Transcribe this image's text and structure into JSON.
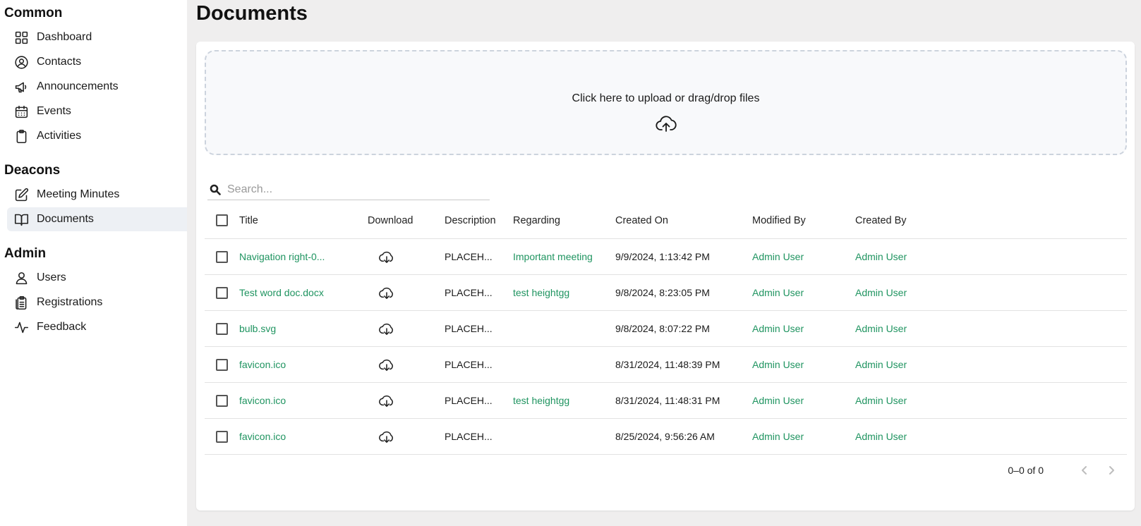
{
  "sidebar": {
    "sections": [
      {
        "title": "Common",
        "items": [
          {
            "label": "Dashboard",
            "icon": "dashboard-icon"
          },
          {
            "label": "Contacts",
            "icon": "contacts-icon"
          },
          {
            "label": "Announcements",
            "icon": "megaphone-icon"
          },
          {
            "label": "Events",
            "icon": "calendar-icon"
          },
          {
            "label": "Activities",
            "icon": "clipboard-icon"
          }
        ]
      },
      {
        "title": "Deacons",
        "items": [
          {
            "label": "Meeting Minutes",
            "icon": "edit-icon"
          },
          {
            "label": "Documents",
            "icon": "book-icon",
            "active": true
          }
        ]
      },
      {
        "title": "Admin",
        "items": [
          {
            "label": "Users",
            "icon": "user-icon"
          },
          {
            "label": "Registrations",
            "icon": "clipboard-list-icon"
          },
          {
            "label": "Feedback",
            "icon": "activity-icon"
          }
        ]
      }
    ]
  },
  "page": {
    "title": "Documents"
  },
  "upload": {
    "text": "Click here to upload or drag/drop files"
  },
  "search": {
    "placeholder": "Search..."
  },
  "table": {
    "columns": [
      "Title",
      "Download",
      "Description",
      "Regarding",
      "Created On",
      "Modified By",
      "Created By"
    ],
    "rows": [
      {
        "title": "Navigation right-0...",
        "description": "PLACEH...",
        "regarding": "Important meeting",
        "created_on": "9/9/2024, 1:13:42 PM",
        "modified_by": "Admin User",
        "created_by": "Admin User"
      },
      {
        "title": "Test word doc.docx",
        "description": "PLACEH...",
        "regarding": "test heightgg",
        "created_on": "9/8/2024, 8:23:05 PM",
        "modified_by": "Admin User",
        "created_by": "Admin User"
      },
      {
        "title": "bulb.svg",
        "description": "PLACEH...",
        "regarding": "",
        "created_on": "9/8/2024, 8:07:22 PM",
        "modified_by": "Admin User",
        "created_by": "Admin User"
      },
      {
        "title": "favicon.ico",
        "description": "PLACEH...",
        "regarding": "",
        "created_on": "8/31/2024, 11:48:39 PM",
        "modified_by": "Admin User",
        "created_by": "Admin User"
      },
      {
        "title": "favicon.ico",
        "description": "PLACEH...",
        "regarding": "test heightgg",
        "created_on": "8/31/2024, 11:48:31 PM",
        "modified_by": "Admin User",
        "created_by": "Admin User"
      },
      {
        "title": "favicon.ico",
        "description": "PLACEH...",
        "regarding": "",
        "created_on": "8/25/2024, 9:56:26 AM",
        "modified_by": "Admin User",
        "created_by": "Admin User"
      }
    ]
  },
  "pagination": {
    "text": "0–0 of 0"
  },
  "colors": {
    "link": "#1f9460",
    "active_nav_bg": "#edf0f4",
    "page_bg": "#efeeee"
  }
}
